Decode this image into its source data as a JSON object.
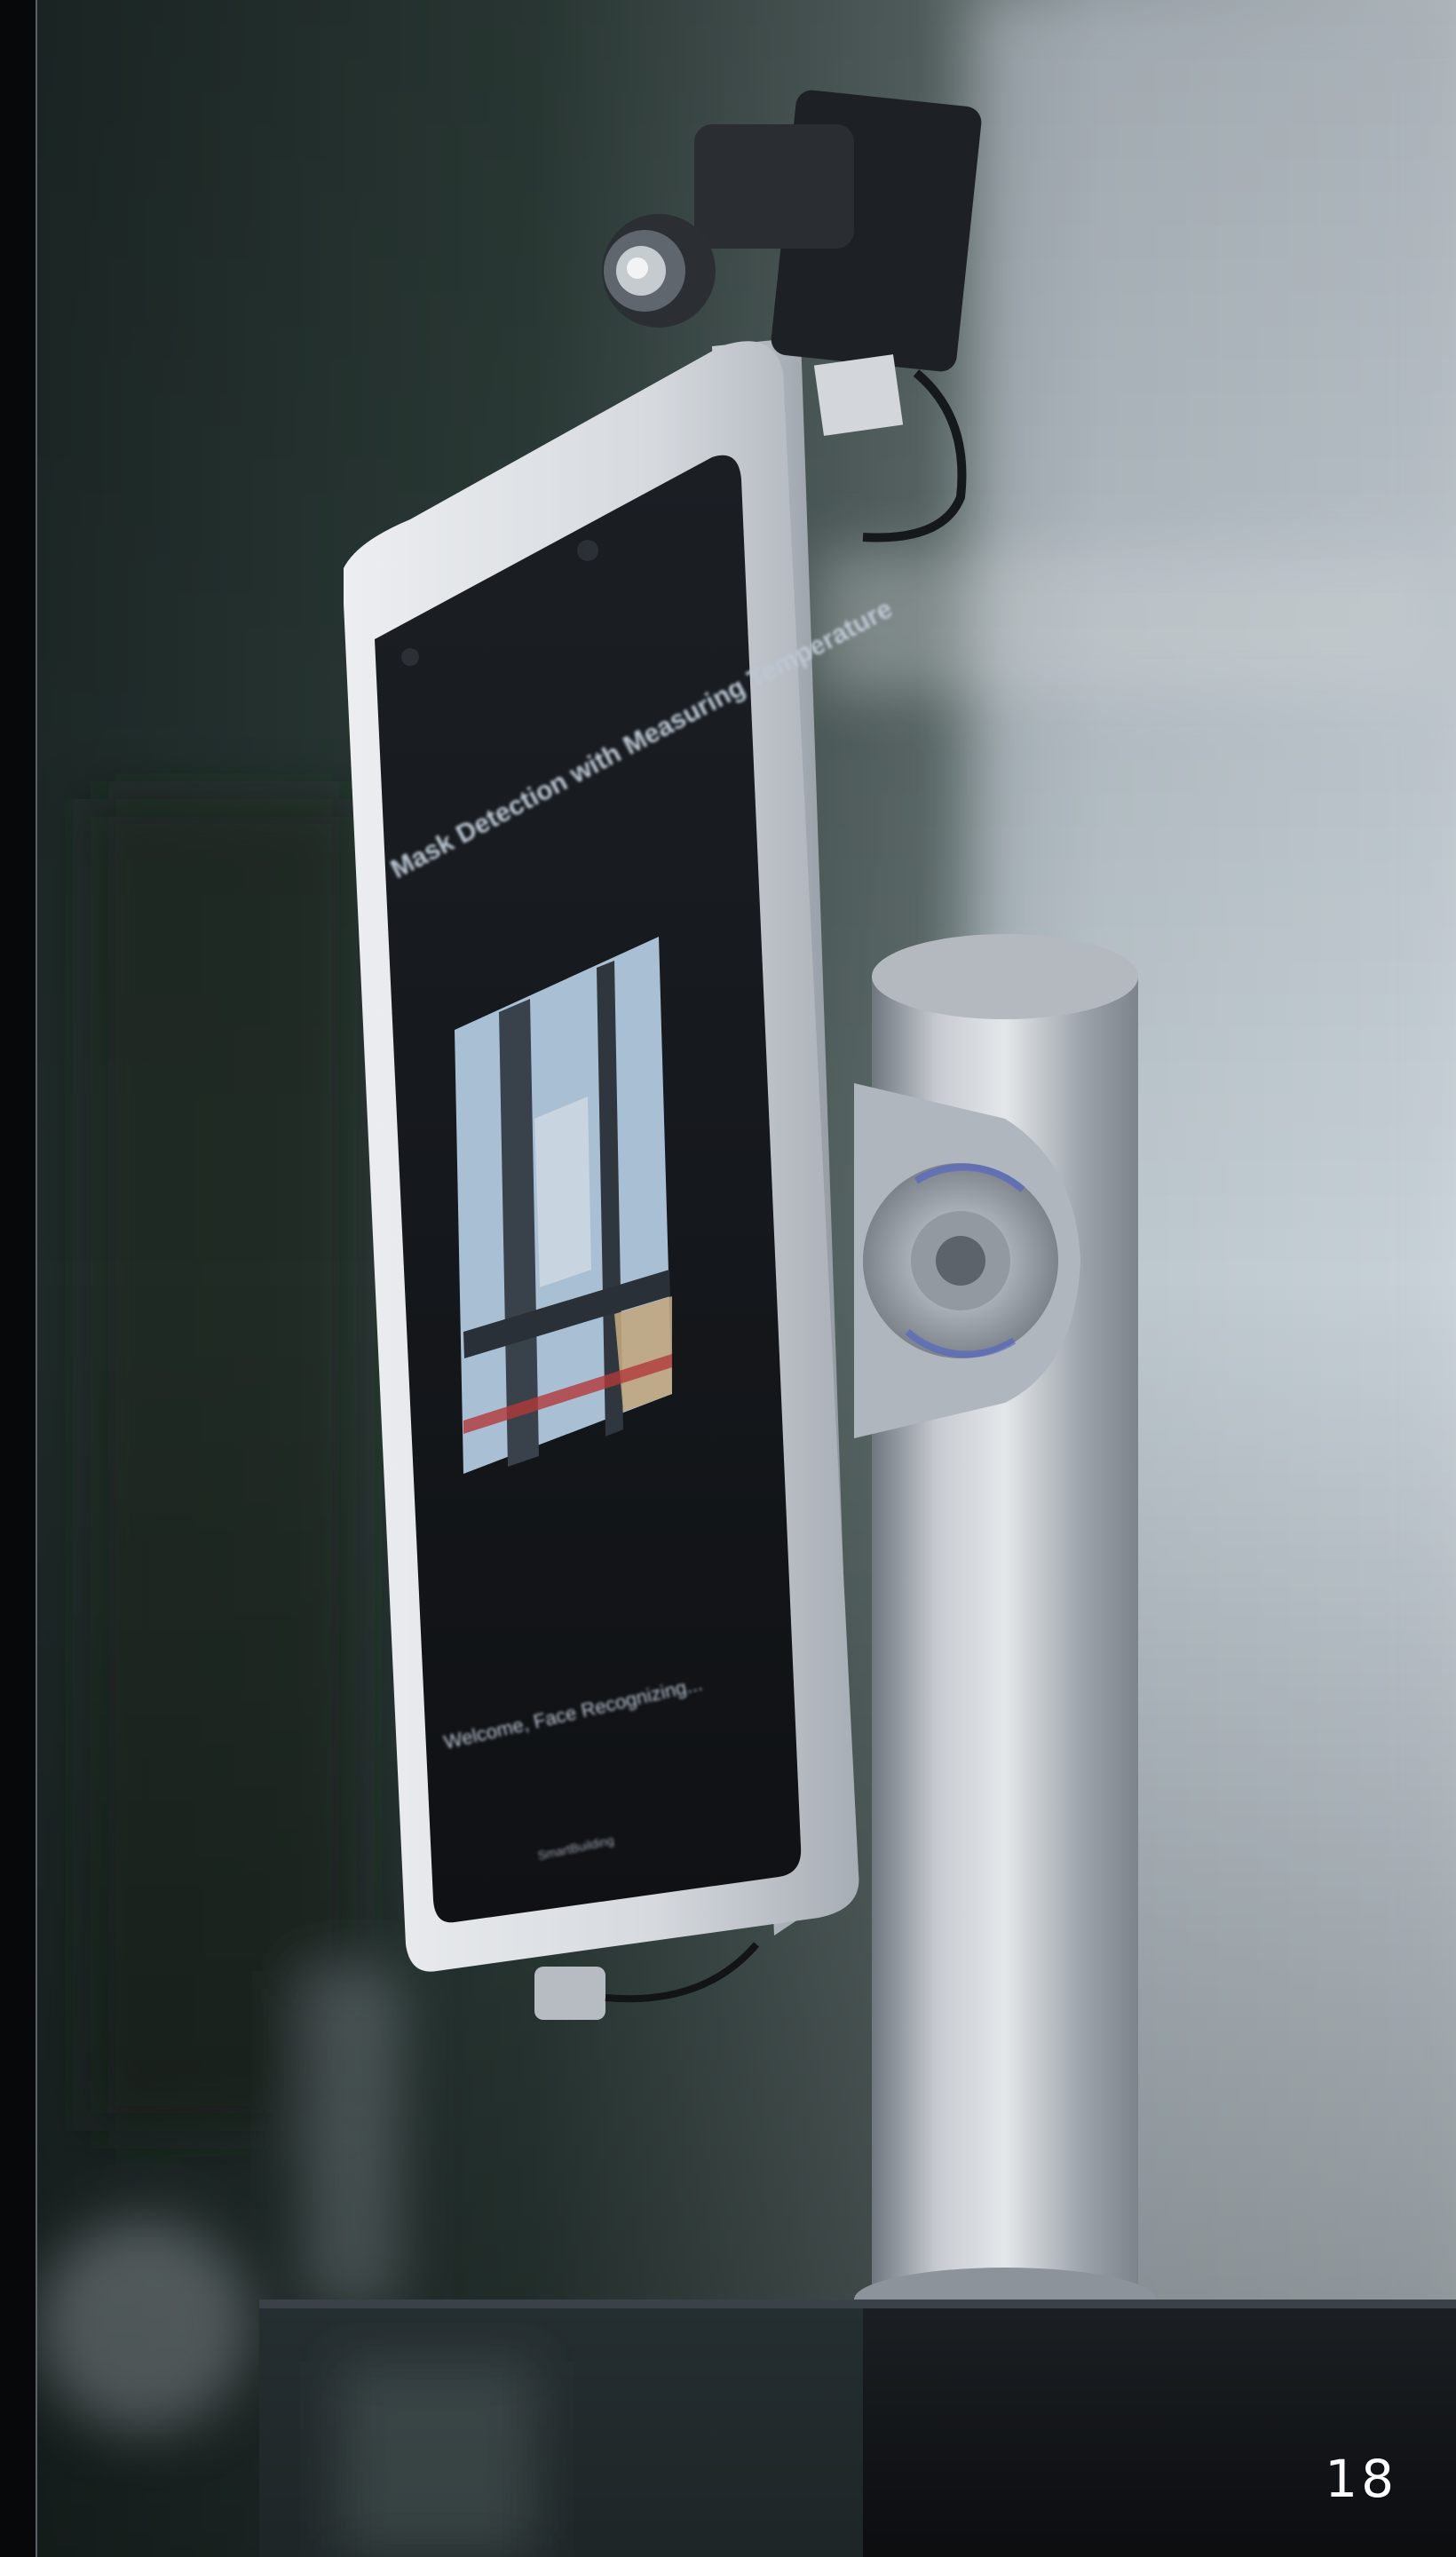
{
  "page": {
    "page_number": "18"
  },
  "device": {
    "screen_title": "Mask Detection with Measuring Temperature",
    "screen_status": "Welcome, Face Recognizing...",
    "screen_footer": "SmartBuilding",
    "colors": {
      "bezel": "#d9dde2",
      "screen": "#14171b",
      "pole": "#b8bdc4",
      "background_left": "#26332f",
      "background_right": "#c7d0d6"
    }
  }
}
